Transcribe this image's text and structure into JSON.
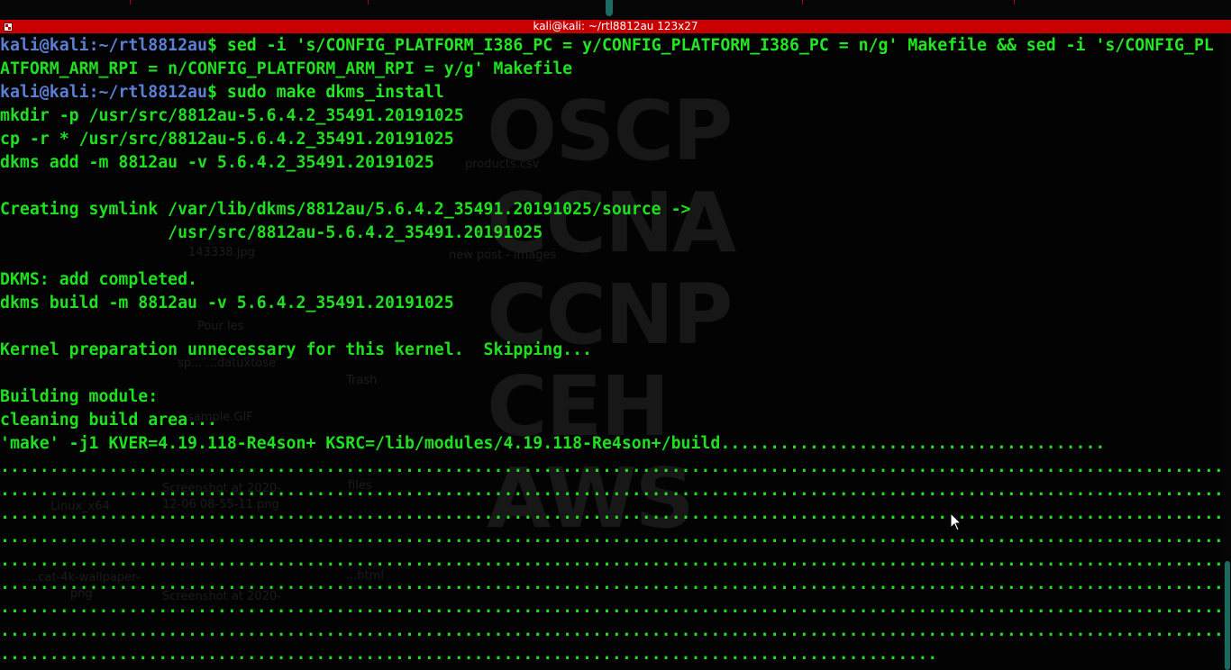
{
  "window": {
    "title": "kali@kali: ~/rtl8812au 123x27"
  },
  "terminal": {
    "prompt_user": "kali@kali",
    "prompt_path": ":~/rtl8812au",
    "prompt_symbol": "$",
    "lines": [
      {
        "type": "prompt",
        "cmd": " sed -i 's/CONFIG_PLATFORM_I386_PC = y/CONFIG_PLATFORM_I386_PC = n/g' Makefile && sed -i 's/CONFIG_PL"
      },
      {
        "type": "out",
        "text": "ATFORM_ARM_RPI = n/CONFIG_PLATFORM_ARM_RPI = y/g' Makefile"
      },
      {
        "type": "prompt",
        "cmd": " sudo make dkms_install"
      },
      {
        "type": "out",
        "text": "mkdir -p /usr/src/8812au-5.6.4.2_35491.20191025"
      },
      {
        "type": "out",
        "text": "cp -r * /usr/src/8812au-5.6.4.2_35491.20191025"
      },
      {
        "type": "out",
        "text": "dkms add -m 8812au -v 5.6.4.2_35491.20191025"
      },
      {
        "type": "out",
        "text": ""
      },
      {
        "type": "out",
        "text": "Creating symlink /var/lib/dkms/8812au/5.6.4.2_35491.20191025/source ->"
      },
      {
        "type": "out",
        "text": "                 /usr/src/8812au-5.6.4.2_35491.20191025"
      },
      {
        "type": "out",
        "text": ""
      },
      {
        "type": "out",
        "text": "DKMS: add completed."
      },
      {
        "type": "out",
        "text": "dkms build -m 8812au -v 5.6.4.2_35491.20191025"
      },
      {
        "type": "out",
        "text": ""
      },
      {
        "type": "out",
        "text": "Kernel preparation unnecessary for this kernel.  Skipping..."
      },
      {
        "type": "out",
        "text": ""
      },
      {
        "type": "out",
        "text": "Building module:"
      },
      {
        "type": "out",
        "text": "cleaning build area..."
      },
      {
        "type": "out",
        "text": "'make' -j1 KVER=4.19.118-Re4son+ KSRC=/lib/modules/4.19.118-Re4son+/build......................................."
      },
      {
        "type": "out",
        "text": "..............................................................................................................................."
      },
      {
        "type": "out",
        "text": "..............................................................................................................................."
      },
      {
        "type": "out",
        "text": "..............................................................................................................................."
      },
      {
        "type": "out",
        "text": "..............................................................................................................................."
      },
      {
        "type": "out",
        "text": "..............................................................................................................................."
      },
      {
        "type": "out",
        "text": "..............................................................................................................................."
      },
      {
        "type": "out",
        "text": "..............................................................................................................................."
      },
      {
        "type": "out",
        "text": "..............................................................................................................................."
      }
    ],
    "last_line": "..............................................................................................."
  },
  "desktop": {
    "watermark": [
      "OSCP",
      "CCNA",
      "CCNP",
      "CEH",
      "AWS"
    ],
    "icons": [
      "products.csv",
      "new post - images",
      "143338.jpg",
      "Pour les",
      "sp... ...datuxtose",
      "Trash",
      "sample.GIF",
      "files",
      "Linux_x64",
      "Screenshot at 2020-",
      "12-06 08-55-11.png",
      "...cat-4k-wallpaper-",
      "png",
      "...html",
      "Screenshot at 2020-"
    ]
  },
  "colors": {
    "title_bar": "#c80000",
    "prompt": "#5b7fd4",
    "text": "#1fe01f",
    "background": "#030303",
    "scroll_thumb": "#1a6a60"
  }
}
